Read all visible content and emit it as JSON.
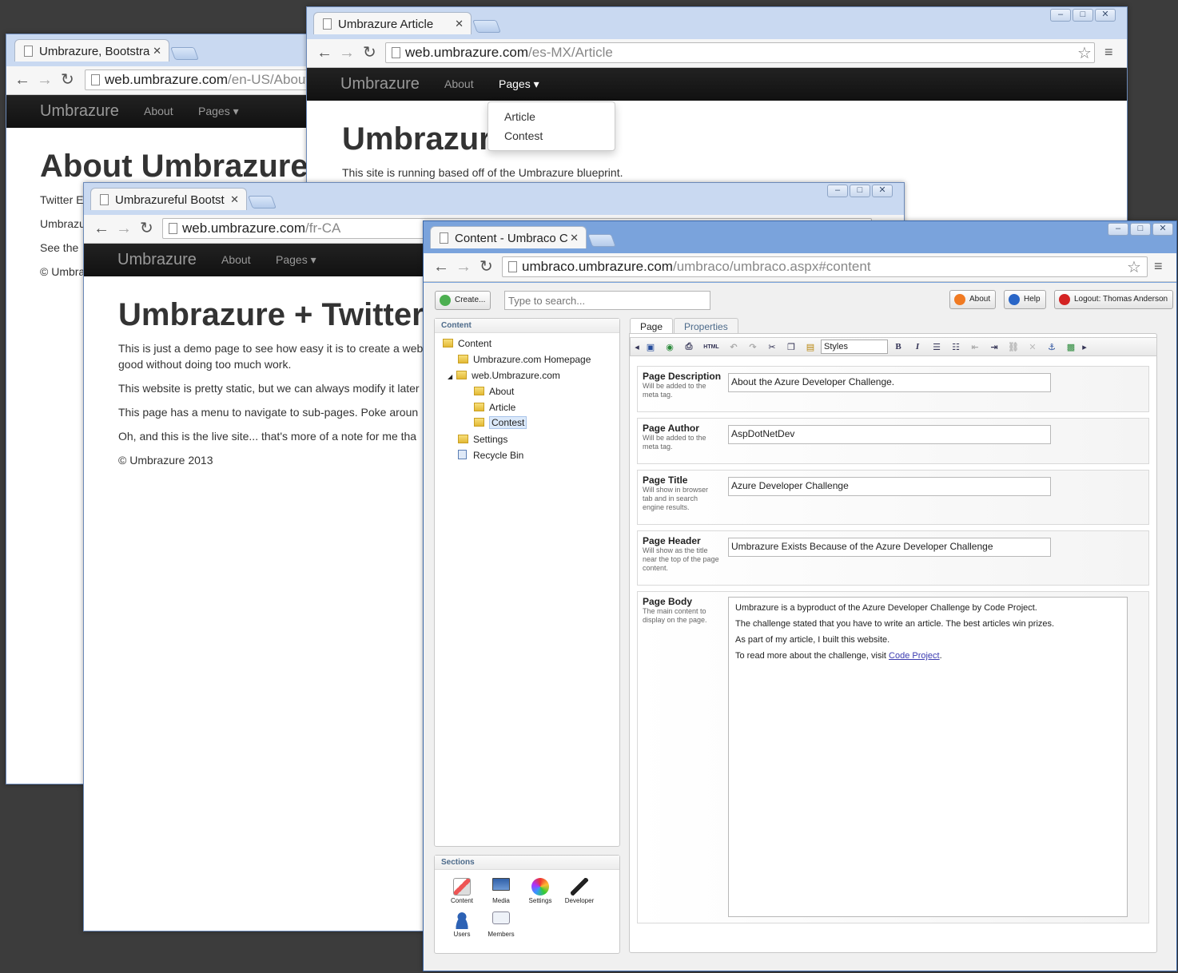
{
  "window_about": {
    "tab_title": "Umbrazure, Bootstra",
    "url_host": "web.umbrazure.com",
    "url_path": "/en-US/About",
    "brand": "Umbrazure",
    "nav_about": "About",
    "nav_pages": "Pages",
    "heading": "About Umbrazure",
    "lines": [
      "Twitter E",
      "Umbrazu",
      "See the",
      "© Umbra"
    ]
  },
  "window_article": {
    "tab_title": "Umbrazure Article",
    "url_host": "web.umbrazure.com",
    "url_path": "/es-MX/Article",
    "brand": "Umbrazure",
    "nav_about": "About",
    "nav_pages": "Pages",
    "dropdown": [
      "Article",
      "Contest"
    ],
    "heading": "Umbrazur",
    "text": "This site is running based off of the Umbrazure blueprint."
  },
  "window_twitter": {
    "tab_title": "Umbrazureful Bootst",
    "url_host": "web.umbrazure.com",
    "url_path": "/fr-CA",
    "brand": "Umbrazure",
    "nav_about": "About",
    "nav_pages": "Pages",
    "heading": "Umbrazure + Twitter",
    "paragraphs": [
      "This is just a demo page to see how easy it is to create a web",
      "good without doing too much work.",
      "This website is pretty static, but we can always modify it later",
      "This page has a menu to navigate to sub-pages. Poke aroun",
      "Oh, and this is the live site... that's more of a note for me tha",
      "© Umbrazure 2013"
    ]
  },
  "window_umbraco": {
    "tab_title": "Content - Umbraco C",
    "url_host": "umbraco.umbrazure.com",
    "url_path": "/umbraco/umbraco.aspx#content",
    "create_button": "Create...",
    "search_placeholder": "Type to search...",
    "about_button": "About",
    "help_button": "Help",
    "logout_button": "Logout: Thomas Anderson",
    "tree_title": "Content",
    "tree": {
      "root": "Content",
      "homepage": "Umbrazure.com Homepage",
      "site": "web.Umbrazure.com",
      "about": "About",
      "article": "Article",
      "contest": "Contest",
      "settings": "Settings",
      "recycle": "Recycle Bin"
    },
    "sections_title": "Sections",
    "sections": [
      "Content",
      "Media",
      "Settings",
      "Developer",
      "Users",
      "Members"
    ],
    "tabs": [
      "Page",
      "Properties"
    ],
    "styles_label": "Styles",
    "properties": [
      {
        "label": "Page Description",
        "desc": "Will be added to the meta tag.",
        "value": "About the Azure Developer Challenge."
      },
      {
        "label": "Page Author",
        "desc": "Will be added to the meta tag.",
        "value": "AspDotNetDev"
      },
      {
        "label": "Page Title",
        "desc": "Will show in browser tab and in search engine results.",
        "value": "Azure Developer Challenge"
      },
      {
        "label": "Page Header",
        "desc": "Will show as the title near the top of the page content.",
        "value": "Umbrazure Exists Because of the Azure Developer Challenge"
      }
    ],
    "body": {
      "label": "Page Body",
      "desc": "The main content to display on the page.",
      "lines": [
        "Umbrazure is a byproduct of the Azure Developer Challenge by Code Project.",
        "The challenge stated that you have to write an article. The best articles win prizes.",
        "As part of my article, I built this website."
      ],
      "last_prefix": "To read more about the challenge, visit ",
      "link": "Code Project",
      "last_suffix": "."
    }
  }
}
